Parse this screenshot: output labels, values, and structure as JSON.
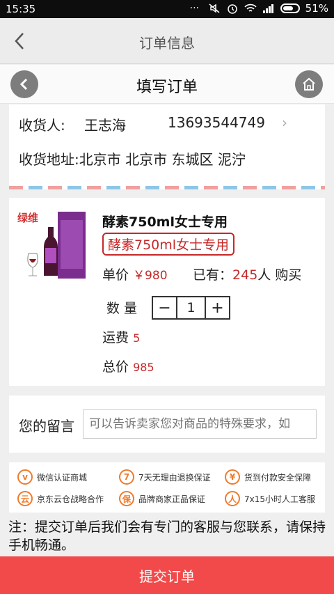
{
  "statusbar": {
    "time": "15:35",
    "battery": "51%"
  },
  "header": {
    "title": "订单信息"
  },
  "subheader": {
    "title": "填写订单"
  },
  "address": {
    "receiver_label": "收货人:",
    "receiver_name": "王志海",
    "phone": "13693544749",
    "address_label": "收货地址:",
    "address_value": "北京市 北京市 东城区 泥泞"
  },
  "product": {
    "title": "酵素750ml女士专用",
    "tag": "酵素750ml女士专用",
    "price_label": "单价",
    "price_value": "￥980",
    "sold_prefix": "已有：",
    "sold_count": "245",
    "sold_suffix": "人 购买",
    "quantity_label": "数 量",
    "quantity_value": "1",
    "minus": "−",
    "plus": "+",
    "shipping_label": "运费",
    "shipping_value": "5",
    "total_label": "总价",
    "total_value": "985",
    "brand_text": "绿维"
  },
  "message": {
    "label": "您的留言",
    "placeholder": "可以告诉卖家您对商品的特殊要求，如"
  },
  "guarantees": [
    {
      "label": "微信认证商城",
      "icon": "v"
    },
    {
      "label": "7天无理由退换保证",
      "icon": "7"
    },
    {
      "label": "货到付款安全保障",
      "icon": "¥"
    },
    {
      "label": "京东云仓战略合作",
      "icon": "云"
    },
    {
      "label": "品牌商家正品保证",
      "icon": "保"
    },
    {
      "label": "7x15小时人工客服",
      "icon": "人"
    }
  ],
  "note": "注：提交订单后我们会有专门的客服与您联系，请保持手机畅通。",
  "submit_label": "提交订单",
  "colors": {
    "accent": "#f24a4a",
    "price": "#c62828",
    "guarantee": "#f07a2a"
  }
}
